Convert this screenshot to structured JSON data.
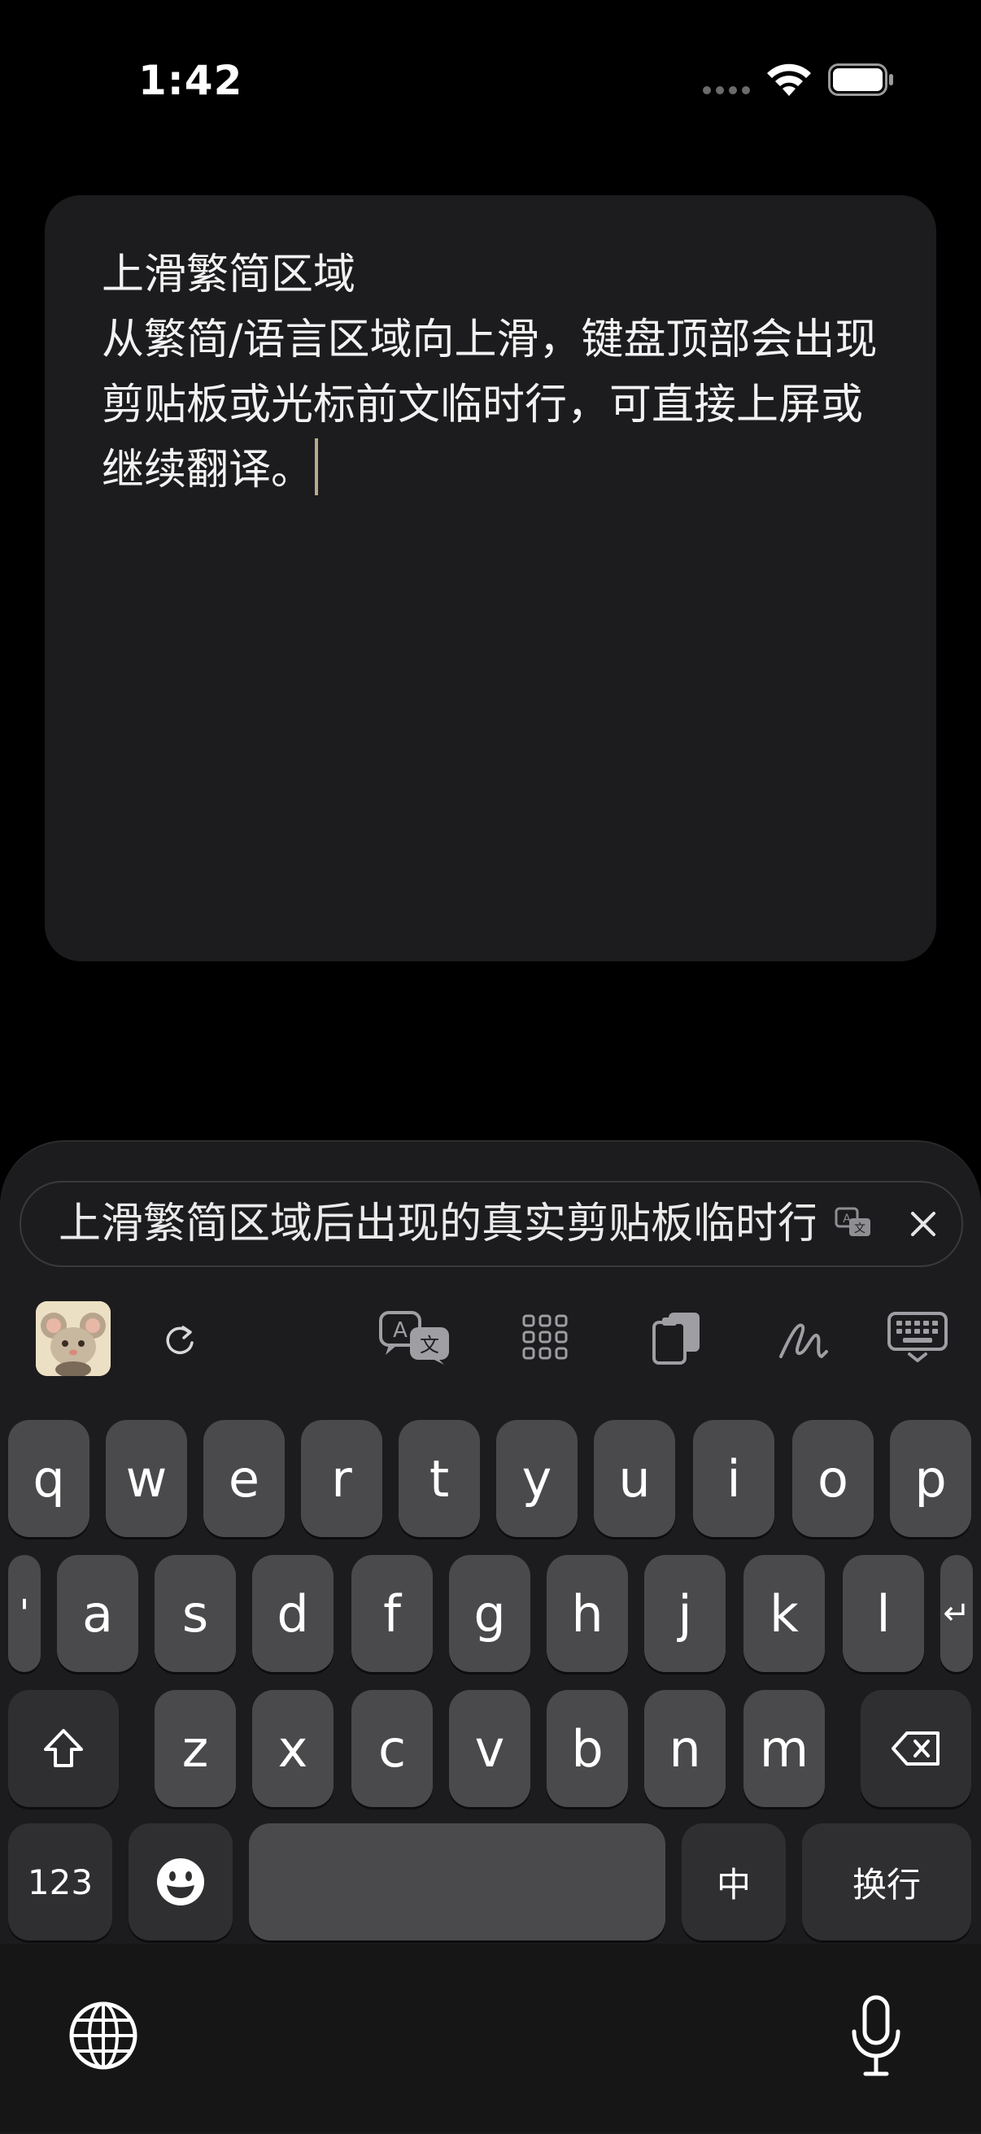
{
  "status_bar": {
    "time": "1:42"
  },
  "note": {
    "text": "上滑繁简区域\n从繁简/语言区域向上滑，键盘顶部会出现剪贴板或光标前文临时行，可直接上屏或继续翻译。"
  },
  "candidate_bar": {
    "text": "上滑繁简区域后出现的真实剪贴板临时行"
  },
  "toolbar": {
    "icons": [
      "app-avatar",
      "refresh-icon",
      "translate-icon",
      "grid-icon",
      "clipboard-icon",
      "handwriting-icon",
      "keyboard-hide-icon"
    ]
  },
  "keyboard": {
    "row1": [
      "q",
      "w",
      "e",
      "r",
      "t",
      "y",
      "u",
      "i",
      "o",
      "p"
    ],
    "row2": [
      "'",
      "a",
      "s",
      "d",
      "f",
      "g",
      "h",
      "j",
      "k",
      "l",
      "↵"
    ],
    "row3": [
      "z",
      "x",
      "c",
      "v",
      "b",
      "n",
      "m"
    ],
    "numbers_label": "123",
    "lang_label": "中",
    "return_label": "换行"
  }
}
